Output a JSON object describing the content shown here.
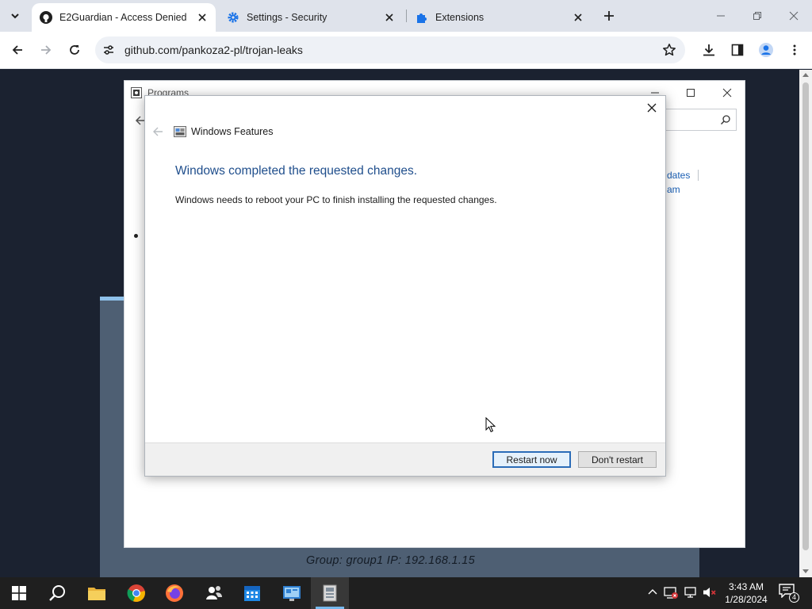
{
  "browser": {
    "tabs": [
      {
        "title": "E2Guardian - Access Denied",
        "icon": "github-icon",
        "active": true
      },
      {
        "title": "Settings - Security",
        "icon": "gear-icon",
        "active": false
      },
      {
        "title": "Extensions",
        "icon": "puzzle-icon",
        "active": false
      }
    ],
    "url": "github.com/pankoza2-pl/trojan-leaks"
  },
  "programs_window": {
    "title": "Programs",
    "link_partial_1": "dates",
    "link_partial_2": "am"
  },
  "dialog": {
    "title": "Windows Features",
    "heading": "Windows completed the requested changes.",
    "body": "Windows needs to reboot your PC to finish installing the requested changes.",
    "restart_label": "Restart now",
    "dont_restart_label": "Don't restart"
  },
  "page": {
    "group_ip": "Group: group1   IP: 192.168.1.15"
  },
  "taskbar": {
    "time": "3:43 AM",
    "date": "1/28/2024",
    "notification_count": "4"
  }
}
